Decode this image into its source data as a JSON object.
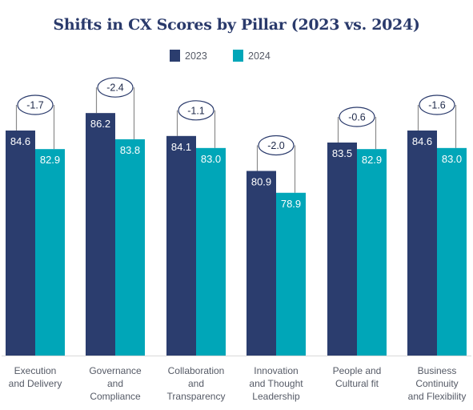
{
  "chart_data": {
    "type": "bar",
    "title": "Shifts in CX Scores by Pillar (2023 vs. 2024)",
    "xlabel": "",
    "ylabel": "",
    "ylim": [
      64,
      87
    ],
    "grid": false,
    "legend_position": "top-center",
    "categories": [
      "Execution and Delivery",
      "Governance and Compliance",
      "Collaboration and Transparency",
      "Innovation and Thought Leadership",
      "People and Cultural fit",
      "Business Continuity and Flexibility"
    ],
    "category_label_lines": [
      [
        "Execution",
        "and Delivery"
      ],
      [
        "Governance",
        "and",
        "Compliance"
      ],
      [
        "Collaboration",
        "and",
        "Transparency"
      ],
      [
        "Innovation",
        "and Thought",
        "Leadership"
      ],
      [
        "People and",
        "Cultural fit"
      ],
      [
        "Business",
        "Continuity",
        "and Flexibility"
      ]
    ],
    "series": [
      {
        "name": "2023",
        "color": "#2b3d6e",
        "values": [
          84.6,
          86.2,
          84.1,
          80.9,
          83.5,
          84.6
        ],
        "labels": [
          "84.6",
          "86.2",
          "84.1",
          "80.9",
          "83.5",
          "84.6"
        ]
      },
      {
        "name": "2024",
        "color": "#00a6b8",
        "values": [
          82.9,
          83.8,
          83.0,
          78.9,
          82.9,
          83.0
        ],
        "labels": [
          "82.9",
          "83.8",
          "83.0",
          "78.9",
          "82.9",
          "83.0"
        ]
      }
    ],
    "annotations": {
      "type": "difference",
      "values": [
        -1.7,
        -2.4,
        -1.1,
        -2.0,
        -0.6,
        -1.6
      ],
      "labels": [
        "-1.7",
        "-2.4",
        "-1.1",
        "-2.0",
        "-0.6",
        "-1.6"
      ]
    }
  },
  "legend": {
    "items": [
      {
        "label": "2023",
        "color": "#2b3d6e"
      },
      {
        "label": "2024",
        "color": "#00a6b8"
      }
    ]
  },
  "colors": {
    "title": "#2a3a6b",
    "axis": "#d9d9d9",
    "connector": "#8a8a8a",
    "bubble_stroke": "#2a3a6b",
    "label_text": "#555a66"
  }
}
